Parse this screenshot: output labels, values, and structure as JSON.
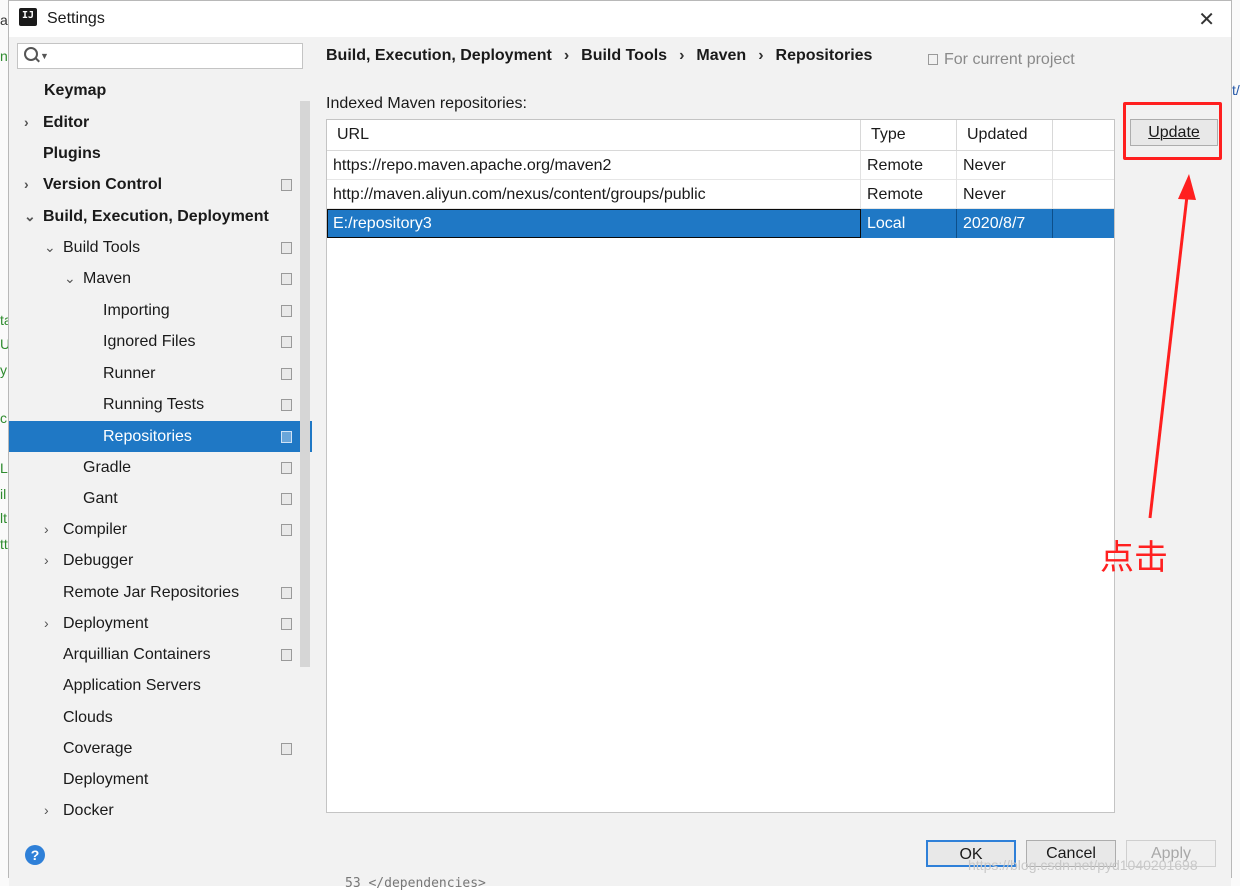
{
  "window": {
    "title": "Settings"
  },
  "search": {
    "placeholder": ""
  },
  "sidebar": {
    "items": [
      {
        "label": "Keymap",
        "arrow": ""
      },
      {
        "label": "Editor",
        "arrow": "›"
      },
      {
        "label": "Plugins",
        "arrow": ""
      },
      {
        "label": "Version Control",
        "arrow": "›"
      },
      {
        "label": "Build, Execution, Deployment",
        "arrow": "⌄"
      },
      {
        "label": "Build Tools",
        "arrow": "⌄"
      },
      {
        "label": "Maven",
        "arrow": "⌄"
      },
      {
        "label": "Importing",
        "arrow": ""
      },
      {
        "label": "Ignored Files",
        "arrow": ""
      },
      {
        "label": "Runner",
        "arrow": ""
      },
      {
        "label": "Running Tests",
        "arrow": ""
      },
      {
        "label": "Repositories",
        "arrow": ""
      },
      {
        "label": "Gradle",
        "arrow": ""
      },
      {
        "label": "Gant",
        "arrow": ""
      },
      {
        "label": "Compiler",
        "arrow": "›"
      },
      {
        "label": "Debugger",
        "arrow": "›"
      },
      {
        "label": "Remote Jar Repositories",
        "arrow": ""
      },
      {
        "label": "Deployment",
        "arrow": "›"
      },
      {
        "label": "Arquillian Containers",
        "arrow": ""
      },
      {
        "label": "Application Servers",
        "arrow": ""
      },
      {
        "label": "Clouds",
        "arrow": ""
      },
      {
        "label": "Coverage",
        "arrow": ""
      },
      {
        "label": "Deployment",
        "arrow": ""
      },
      {
        "label": "Docker",
        "arrow": "›"
      }
    ]
  },
  "breadcrumb": {
    "items": [
      "Build, Execution, Deployment",
      "Build Tools",
      "Maven",
      "Repositories"
    ],
    "separator": "›"
  },
  "scope_note": "For current project",
  "repos": {
    "section_label": "Indexed Maven repositories:",
    "columns": [
      "URL",
      "Type",
      "Updated"
    ],
    "rows": [
      {
        "url": "https://repo.maven.apache.org/maven2",
        "type": "Remote",
        "updated": "Never"
      },
      {
        "url": "http://maven.aliyun.com/nexus/content/groups/public",
        "type": "Remote",
        "updated": "Never"
      },
      {
        "url": "E:/repository3",
        "type": "Local",
        "updated": "2020/8/7"
      }
    ],
    "selected_row": 2
  },
  "buttons": {
    "update": "Update",
    "ok": "OK",
    "cancel": "Cancel",
    "apply": "Apply",
    "help": "?"
  },
  "annotation": {
    "text": "点击",
    "color": "#ff2020"
  },
  "background": {
    "fragments": [
      "al",
      "n.",
      "ta",
      "U",
      "y",
      "c",
      "L",
      "il",
      "lt",
      "tt",
      "t/"
    ],
    "code_line": "53     </dependencies>"
  },
  "watermark": "https://blog.csdn.net/pyd1040201698",
  "colors": {
    "selection": "#1f78c5",
    "accent": "#2f80d8",
    "annotation": "#ff1f1f"
  },
  "icons": {
    "app": "intellij-icon",
    "close": "close-icon",
    "search": "search-icon",
    "help": "help-icon",
    "scope": "project-scope-icon"
  }
}
